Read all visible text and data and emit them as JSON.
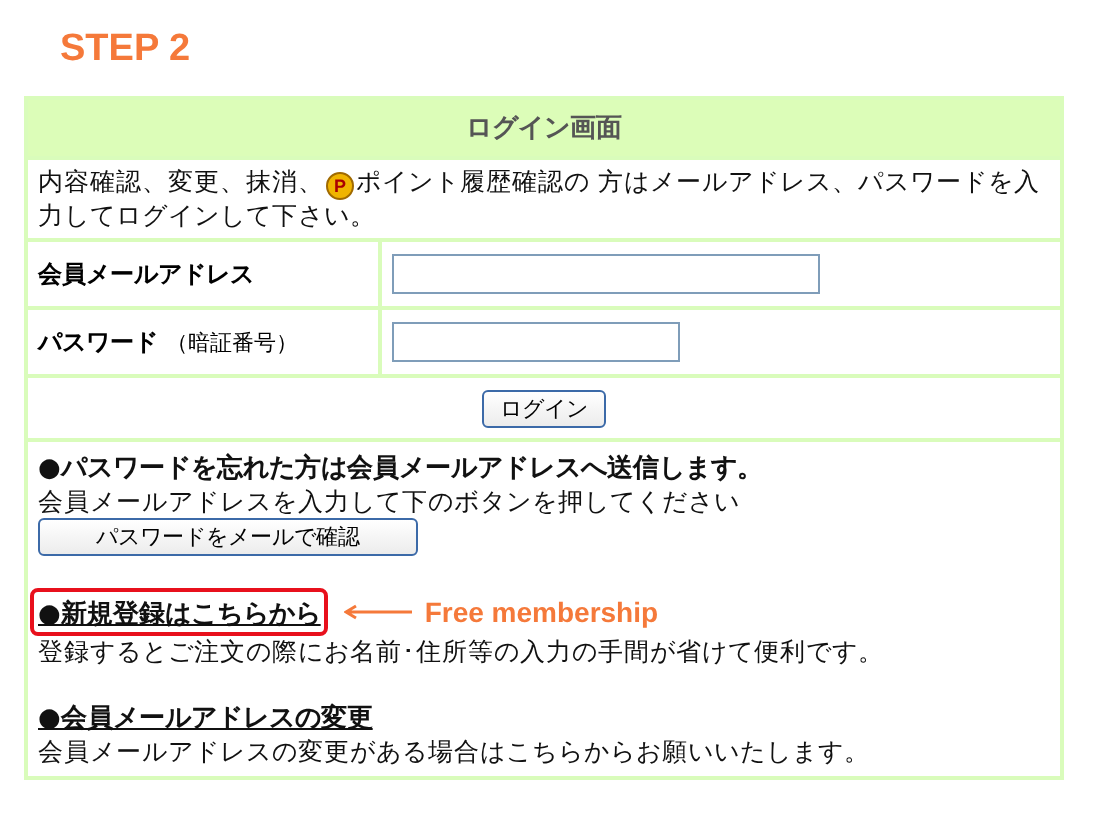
{
  "step_title": "STEP 2",
  "panel_title": "ログイン画面",
  "intro": {
    "start": "内容確認、変更、抹消、",
    "badge": "P",
    "end": "ポイント履歴確認の 方はメールアドレス、パスワードを入力してログインして下さい。"
  },
  "fields": [
    {
      "label": "会員メールアドレス",
      "wide": true
    },
    {
      "label": "パスワード",
      "note": "（暗証番号）",
      "wide": false
    }
  ],
  "login_button": "ログイン",
  "sections": [
    {
      "kind": "plain",
      "heading": "●パスワードを忘れた方は会員メールアドレスへ送信します。",
      "text": "会員メールアドレスを入力して下のボタンを押してください",
      "button": "パスワードをメールで確認"
    },
    {
      "kind": "link",
      "heading": "●新規登録はこちらから",
      "text": "登録するとご注文の際にお名前･住所等の入力の手間が省けて便利です。",
      "highlighted": true,
      "callout": "Free membership"
    },
    {
      "kind": "link",
      "heading": "●会員メールアドレスの変更",
      "text": "会員メールアドレスの変更がある場合はこちらからお願いいたします。",
      "highlighted": false
    }
  ]
}
